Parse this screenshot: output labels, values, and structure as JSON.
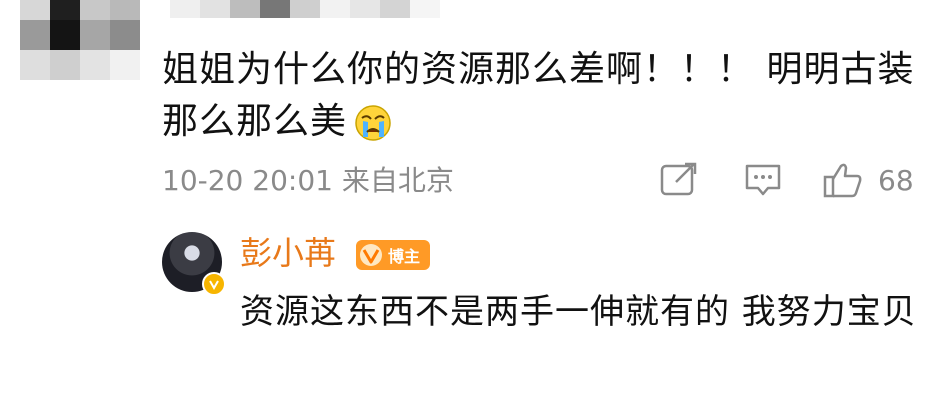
{
  "comment": {
    "text": "姐姐为什么你的资源那么差啊！！！ 明明古装那么那么美",
    "emoji": "crying-face-emoji",
    "timestamp": "10-20 20:01 来自北京",
    "like_count": "68"
  },
  "reply": {
    "username": "彭小苒",
    "role_badge": "博主",
    "text": "资源这东西不是两手一伸就有的 我努力宝贝"
  },
  "colors": {
    "username": "#e8791a",
    "badge": "#ff9a26",
    "meta": "#8a8a8a"
  }
}
